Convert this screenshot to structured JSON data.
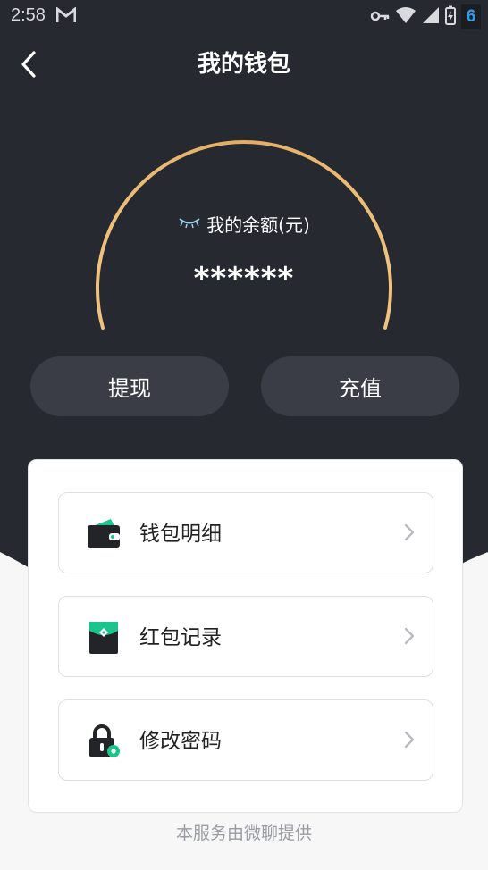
{
  "status_bar": {
    "time": "2:58",
    "battery_level": "6"
  },
  "header": {
    "title": "我的钱包"
  },
  "balance": {
    "label": "我的余额(元)",
    "value": "******"
  },
  "actions": {
    "withdraw_label": "提现",
    "recharge_label": "充值"
  },
  "menu": {
    "items": [
      {
        "label": "钱包明细",
        "icon": "wallet-icon"
      },
      {
        "label": "红包记录",
        "icon": "red-packet-icon"
      },
      {
        "label": "修改密码",
        "icon": "lock-icon"
      }
    ]
  },
  "footer": {
    "note": "本服务由微聊提供"
  },
  "colors": {
    "background_dark": "#262930",
    "accent_gold": "#e7b46a",
    "accent_green": "#1bc48a",
    "page_bg": "#f7f7f8"
  }
}
